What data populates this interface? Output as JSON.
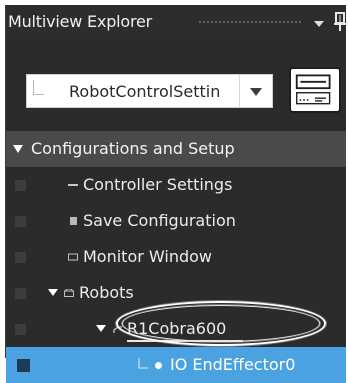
{
  "explorer": {
    "title": "Multiview Explorer",
    "menu_icon": "dropdown-arrow-icon",
    "pin_icon": "pin-icon"
  },
  "device_selector": {
    "value": "RobotControlSettin",
    "device_icon": "controller-device-icon"
  },
  "tree": {
    "root_label": "Configurations and Setup",
    "items": [
      {
        "label": "Controller Settings",
        "icon": "dash-icon"
      },
      {
        "label": "Save Configuration",
        "icon": "save-icon"
      },
      {
        "label": "Monitor Window",
        "icon": "monitor-icon"
      },
      {
        "label": "Robots",
        "icon": "robots-folder-icon"
      },
      {
        "label": "R1Cobra600",
        "icon": "robot-arm-icon"
      },
      {
        "label": "IO EndEffector0",
        "icon": "io-endeffector-icon"
      }
    ]
  },
  "colors": {
    "panel_background": "#2b2b2b",
    "selected_row": "#4aa3e0",
    "root_row": "#4a4a4c"
  }
}
